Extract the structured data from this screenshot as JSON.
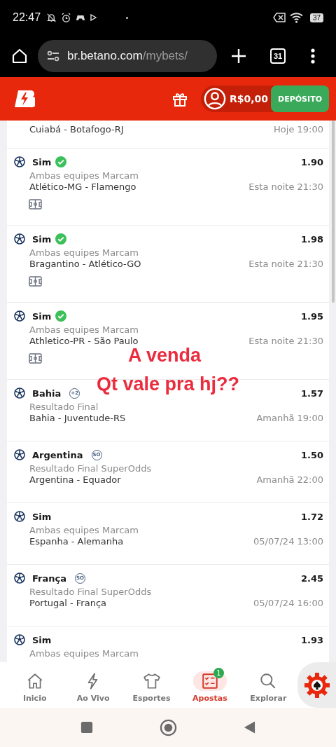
{
  "status_bar": {
    "time": "22:47",
    "battery": "37"
  },
  "browser": {
    "url_host": "br.betano.com",
    "url_path": "/mybets/",
    "tab_count": "31"
  },
  "header": {
    "balance": "R$0,00",
    "deposit_button": "DEPÓSITO"
  },
  "bets": [
    {
      "kind": "partial_top",
      "match": "Cuiabá - Botafogo-RJ",
      "time": "Hoje 19:00"
    },
    {
      "kind": "full",
      "selection": "Sim",
      "won": true,
      "odds": "1.90",
      "market": "Ambas equipes Marcam",
      "match": "Atlético-MG - Flamengo",
      "time": "Esta noite 21:30",
      "stats": true
    },
    {
      "kind": "full",
      "selection": "Sim",
      "won": true,
      "odds": "1.98",
      "market": "Ambas equipes Marcam",
      "match": "Bragantino - Atlético-GO",
      "time": "Esta noite 21:30",
      "stats": true
    },
    {
      "kind": "full",
      "selection": "Sim",
      "won": true,
      "odds": "1.95",
      "market": "Ambas equipes Marcam",
      "match": "Athletico-PR - São Paulo",
      "time": "Esta noite 21:30",
      "stats": true
    },
    {
      "kind": "full",
      "selection": "Bahia",
      "won": false,
      "badge": "+2",
      "odds": "1.57",
      "market": "Resultado Final",
      "match": "Bahia - Juventude-RS",
      "time": "Amanhã 19:00",
      "stats": false
    },
    {
      "kind": "full",
      "selection": "Argentina",
      "won": false,
      "badge": "SO",
      "odds": "1.50",
      "market": "Resultado Final SuperOdds",
      "match": "Argentina - Equador",
      "time": "Amanhã 22:00",
      "stats": false
    },
    {
      "kind": "full",
      "selection": "Sim",
      "won": false,
      "odds": "1.72",
      "market": "Ambas equipes Marcam",
      "match": "Espanha - Alemanha",
      "time": "05/07/24 13:00",
      "stats": false
    },
    {
      "kind": "full",
      "selection": "França",
      "won": false,
      "badge": "SO",
      "odds": "2.45",
      "market": "Resultado Final SuperOdds",
      "match": "Portugal - França",
      "time": "05/07/24 16:00",
      "stats": false
    },
    {
      "kind": "partial_bottom",
      "selection": "Sim",
      "won": false,
      "odds": "1.93",
      "market": "Ambas equipes Marcam"
    }
  ],
  "annotations": [
    "A venda",
    "Qt vale pra hj??"
  ],
  "bottom_nav": [
    {
      "label": "Inicio",
      "selected": false
    },
    {
      "label": "Ao Vivo",
      "selected": false
    },
    {
      "label": "Esportes",
      "selected": false
    },
    {
      "label": "Apostas",
      "selected": true,
      "badge": "1"
    },
    {
      "label": "Explorar",
      "selected": false
    }
  ]
}
